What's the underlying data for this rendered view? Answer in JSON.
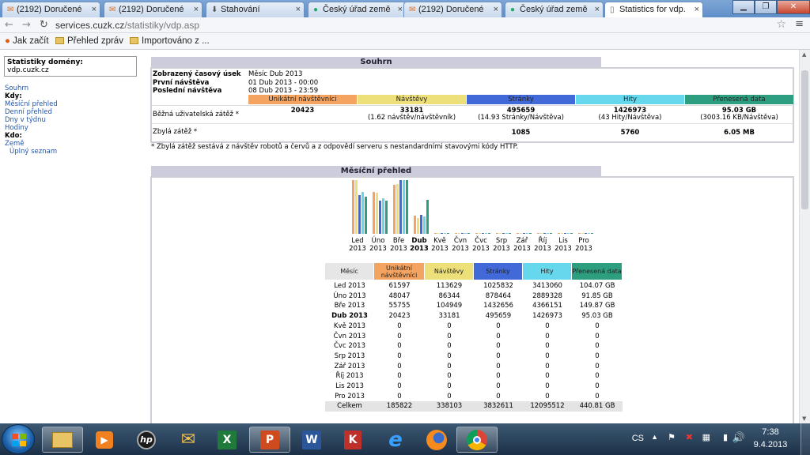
{
  "browser": {
    "tabs": [
      {
        "label": "(2192) Doručené",
        "icon": "mail-icon"
      },
      {
        "label": "(2192) Doručené",
        "icon": "mail-icon"
      },
      {
        "label": "Stahování",
        "icon": "download-icon"
      },
      {
        "label": "Český úřad země",
        "icon": "globe-icon"
      },
      {
        "label": "(2192) Doručené",
        "icon": "mail-icon"
      },
      {
        "label": "Český úřad země",
        "icon": "globe-icon"
      },
      {
        "label": "Statistics for vdp.",
        "icon": "page-icon"
      }
    ],
    "url_host": "services.cuzk.cz",
    "url_path": "/statistiky/vdp.asp",
    "bookmarks": [
      "Jak začít",
      "Přehled zpráv",
      "Importováno z ..."
    ]
  },
  "sidebar": {
    "domain_label": "Statistiky domény:",
    "domain": "vdp.cuzk.cz",
    "items": [
      {
        "label": "Souhrn",
        "type": "link"
      },
      {
        "label": "Kdy:",
        "type": "head"
      },
      {
        "label": "Měsíční přehled",
        "type": "link"
      },
      {
        "label": "Denní přehled",
        "type": "link"
      },
      {
        "label": "Dny v týdnu",
        "type": "link"
      },
      {
        "label": "Hodiny",
        "type": "link"
      },
      {
        "label": "Kdo:",
        "type": "head"
      },
      {
        "label": "Země",
        "type": "link"
      },
      {
        "label": "Úplný seznam",
        "type": "sub"
      }
    ]
  },
  "summary": {
    "title": "Souhrn",
    "period_label": "Zobrazený časový úsek",
    "period_value": "Měsíc Dub 2013",
    "first_label": "První návštěva",
    "first_value": "01 Dub 2013 - 00:00",
    "last_label": "Poslední návštěva",
    "last_value": "08 Dub 2013 - 23:59",
    "col_unique": "Unikátní návštěvníci",
    "col_visits": "Návštěvy",
    "col_pages": "Stránky",
    "col_hits": "Hity",
    "col_data": "Přenesená data",
    "normal_label": "Běžná uživatelská zátěž *",
    "normal": {
      "unique": "20423",
      "visits": "33181",
      "visits_sub": "(1.62 návštěv/návštěvník)",
      "pages": "495659",
      "pages_sub": "(14.93 Stránky/Návštěva)",
      "hits": "1426973",
      "hits_sub": "(43 Hity/Návštěva)",
      "data": "95.03 GB",
      "data_sub": "(3003.16 KB/Návštěva)"
    },
    "other_label": "Zbylá zátěž *",
    "other": {
      "pages": "1085",
      "hits": "5760",
      "data": "6.05 MB"
    },
    "footnote": "* Zbylá zátěž sestává z návštěv robotů a červů a z odpovědí serveru s nestandardními stavovými kódy HTTP."
  },
  "monthly": {
    "title": "Měsíční přehled",
    "col_month": "Měsíc",
    "col_unique": "Unikátní návštěvníci",
    "col_visits": "Návštěvy",
    "col_pages": "Stránky",
    "col_hits": "Hity",
    "col_data": "Přenesená data",
    "rows": [
      {
        "m": "Led 2013",
        "u": "61597",
        "v": "113629",
        "p": "1025832",
        "h": "3413060",
        "d": "104.07 GB"
      },
      {
        "m": "Úno 2013",
        "u": "48047",
        "v": "86344",
        "p": "878464",
        "h": "2889328",
        "d": "91.85 GB"
      },
      {
        "m": "Bře 2013",
        "u": "55755",
        "v": "104949",
        "p": "1432656",
        "h": "4366151",
        "d": "149.87 GB"
      },
      {
        "m": "Dub 2013",
        "u": "20423",
        "v": "33181",
        "p": "495659",
        "h": "1426973",
        "d": "95.03 GB"
      },
      {
        "m": "Kvě 2013",
        "u": "0",
        "v": "0",
        "p": "0",
        "h": "0",
        "d": "0"
      },
      {
        "m": "Čvn 2013",
        "u": "0",
        "v": "0",
        "p": "0",
        "h": "0",
        "d": "0"
      },
      {
        "m": "Čvc 2013",
        "u": "0",
        "v": "0",
        "p": "0",
        "h": "0",
        "d": "0"
      },
      {
        "m": "Srp 2013",
        "u": "0",
        "v": "0",
        "p": "0",
        "h": "0",
        "d": "0"
      },
      {
        "m": "Zář 2013",
        "u": "0",
        "v": "0",
        "p": "0",
        "h": "0",
        "d": "0"
      },
      {
        "m": "Říj 2013",
        "u": "0",
        "v": "0",
        "p": "0",
        "h": "0",
        "d": "0"
      },
      {
        "m": "Lis 2013",
        "u": "0",
        "v": "0",
        "p": "0",
        "h": "0",
        "d": "0"
      },
      {
        "m": "Pro 2013",
        "u": "0",
        "v": "0",
        "p": "0",
        "h": "0",
        "d": "0"
      }
    ],
    "total": {
      "m": "Celkem",
      "u": "185822",
      "v": "338103",
      "p": "3832611",
      "h": "12095512",
      "d": "440.81 GB"
    },
    "chart_months": [
      [
        "Led",
        "2013"
      ],
      [
        "Úno",
        "2013"
      ],
      [
        "Bře",
        "2013"
      ],
      [
        "Dub",
        "2013"
      ],
      [
        "Kvě",
        "2013"
      ],
      [
        "Čvn",
        "2013"
      ],
      [
        "Čvc",
        "2013"
      ],
      [
        "Srp",
        "2013"
      ],
      [
        "Zář",
        "2013"
      ],
      [
        "Říj",
        "2013"
      ],
      [
        "Lis",
        "2013"
      ],
      [
        "Pro",
        "2013"
      ]
    ]
  },
  "colors": {
    "unique": "#f4a460",
    "visits": "#ede07a",
    "pages": "#4169d8",
    "hits": "#66d8ee",
    "data": "#2e9e80"
  },
  "taskbar": {
    "apps": [
      "folder-icon",
      "media-player-icon",
      "hp-icon",
      "mail-icon",
      "excel-icon",
      "powerpoint-icon",
      "word-icon",
      "kaspersky-icon",
      "ie-icon",
      "firefox-icon",
      "chrome-icon"
    ],
    "lang": "CS",
    "time": "7:38",
    "date": "9.4.2013"
  }
}
